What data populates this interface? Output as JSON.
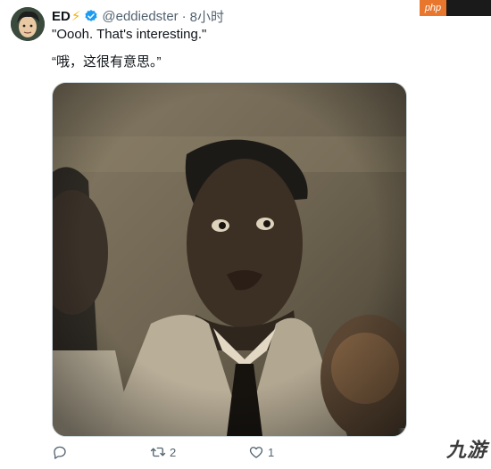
{
  "tweet": {
    "author_name": "ED",
    "author_emoji": "⚡",
    "handle": "@eddiedster",
    "separator": "·",
    "time": "8小时",
    "text_en": "\"Oooh. That's interesting.\"",
    "text_zh": "“哦，这很有意思。”"
  },
  "actions": {
    "reply_count": "",
    "retweet_count": "2",
    "like_count": "1"
  },
  "watermarks": {
    "top": "php",
    "bottom": "九游"
  },
  "colors": {
    "verified": "#1d9bf0",
    "secondary_text": "#536471",
    "bolt": "#f5b301"
  }
}
